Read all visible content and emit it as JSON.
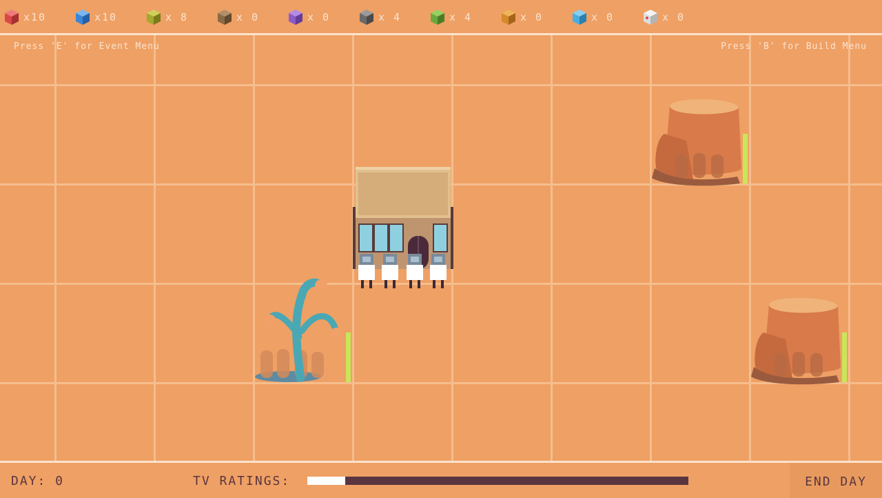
{
  "resources": [
    {
      "icon": "red-cube-icon",
      "color": "#d94848",
      "count": "x10"
    },
    {
      "icon": "blue-cube-icon",
      "color": "#3a86d8",
      "count": "x10"
    },
    {
      "icon": "olive-cube-icon",
      "color": "#a6a82c",
      "count": "x 8"
    },
    {
      "icon": "brown-cube-icon",
      "color": "#8a6a44",
      "count": "x 0"
    },
    {
      "icon": "purple-cube-icon",
      "color": "#8c5ac8",
      "count": "x 0"
    },
    {
      "icon": "gray-cube-icon",
      "color": "#6a6a6a",
      "count": "x 4"
    },
    {
      "icon": "green-cube-icon",
      "color": "#6aa83c",
      "count": "x 4"
    },
    {
      "icon": "orange-cube-icon",
      "color": "#d68a2a",
      "count": "x 0"
    },
    {
      "icon": "cyan-cube-icon",
      "color": "#4aaee0",
      "count": "x 0"
    },
    {
      "icon": "white-medkit-cube-icon",
      "color": "#dcdcdc",
      "count": "x 0"
    }
  ],
  "hints": {
    "event": "Press 'E' for Event Menu",
    "build": "Press 'B' for Build Menu"
  },
  "bottom": {
    "day": "DAY: 0",
    "tv_label": "TV RATINGS:",
    "tv_rating_fraction": 0.1,
    "end_day": "END DAY"
  },
  "colors": {
    "ground": "#efa064",
    "grid": "#f5be8e",
    "text_light": "#fbe3cf",
    "text_dark": "#5a3540",
    "health": "#c9e65a"
  },
  "map_objects": [
    {
      "name": "main-building",
      "type": "building",
      "crew_count": 4
    },
    {
      "name": "alien-tree",
      "type": "plant",
      "health": 1.0
    },
    {
      "name": "rock-stump-top-right",
      "type": "rock",
      "health": 1.0
    },
    {
      "name": "rock-stump-bottom-right",
      "type": "rock",
      "health": 1.0
    }
  ]
}
